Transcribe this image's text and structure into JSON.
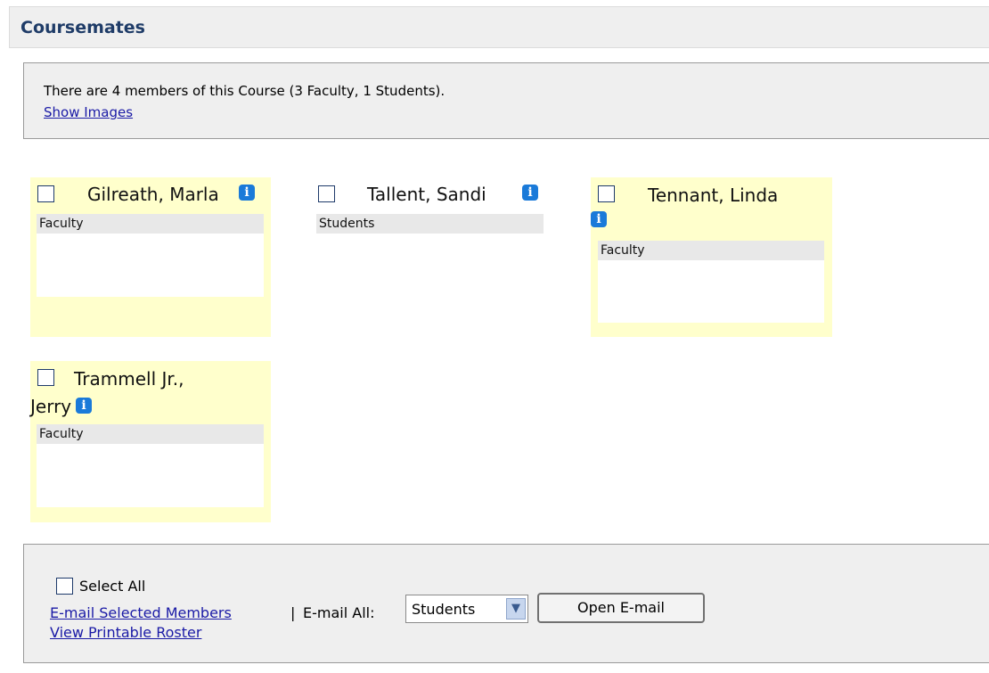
{
  "header": {
    "title": "Coursemates"
  },
  "info": {
    "summary": "There are 4 members of this Course (3 Faculty, 1 Students).",
    "show_images": "Show Images"
  },
  "members": [
    {
      "name": "Gilreath, Marla",
      "role": "Faculty"
    },
    {
      "name": "Tallent, Sandi",
      "role": "Students"
    },
    {
      "name": "Tennant, Linda",
      "role": "Faculty"
    },
    {
      "name_line1": "Trammell Jr.,",
      "name_line2": "Jerry",
      "role": "Faculty"
    }
  ],
  "footer": {
    "select_all": "Select All",
    "email_selected": "E-mail Selected Members",
    "separator": "|",
    "email_all_label": "E-mail All:",
    "email_all_value": "Students",
    "open_email": "Open E-mail",
    "printable_roster": "View Printable Roster"
  }
}
